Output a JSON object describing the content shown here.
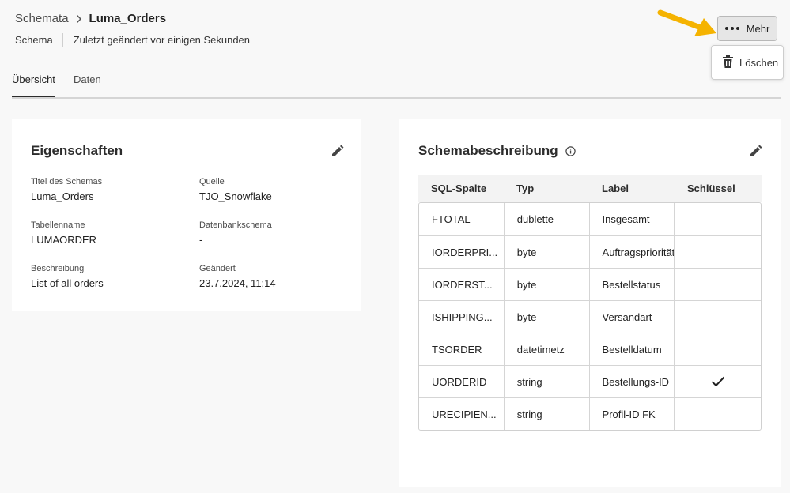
{
  "breadcrumb": {
    "parent": "Schemata",
    "current": "Luma_Orders"
  },
  "subline": {
    "type": "Schema",
    "modified": "Zuletzt geändert vor einigen Sekunden"
  },
  "actions": {
    "more_label": "Mehr",
    "delete_label": "Löschen",
    "arrow_color": "#f5b301"
  },
  "tabs": [
    {
      "label": "Übersicht"
    },
    {
      "label": "Daten"
    }
  ],
  "properties": {
    "title": "Eigenschaften",
    "fields": [
      {
        "label": "Titel des Schemas",
        "value": "Luma_Orders"
      },
      {
        "label": "Quelle",
        "value": "TJO_Snowflake"
      },
      {
        "label": "Tabellenname",
        "value": "LUMAORDER"
      },
      {
        "label": "Datenbankschema",
        "value": "-"
      },
      {
        "label": "Beschreibung",
        "value": "List of all orders"
      },
      {
        "label": "Geändert",
        "value": "23.7.2024, 11:14"
      }
    ]
  },
  "schema": {
    "title": "Schemabeschreibung",
    "columns": [
      "SQL-Spalte",
      "Typ",
      "Label",
      "Schlüssel"
    ],
    "rows": [
      [
        "FTOTAL",
        "dublette",
        "Insgesamt",
        ""
      ],
      [
        "IORDERPRI...",
        "byte",
        "Auftragspriorität",
        ""
      ],
      [
        "IORDERST...",
        "byte",
        "Bestellstatus",
        ""
      ],
      [
        "ISHIPPING...",
        "byte",
        "Versandart",
        ""
      ],
      [
        "TSORDER",
        "datetimetz",
        "Bestelldatum",
        ""
      ],
      [
        "UORDERID",
        "string",
        "Bestellungs-ID",
        "check"
      ],
      [
        "URECIPIEN...",
        "string",
        "Profil-ID FK",
        ""
      ]
    ]
  }
}
